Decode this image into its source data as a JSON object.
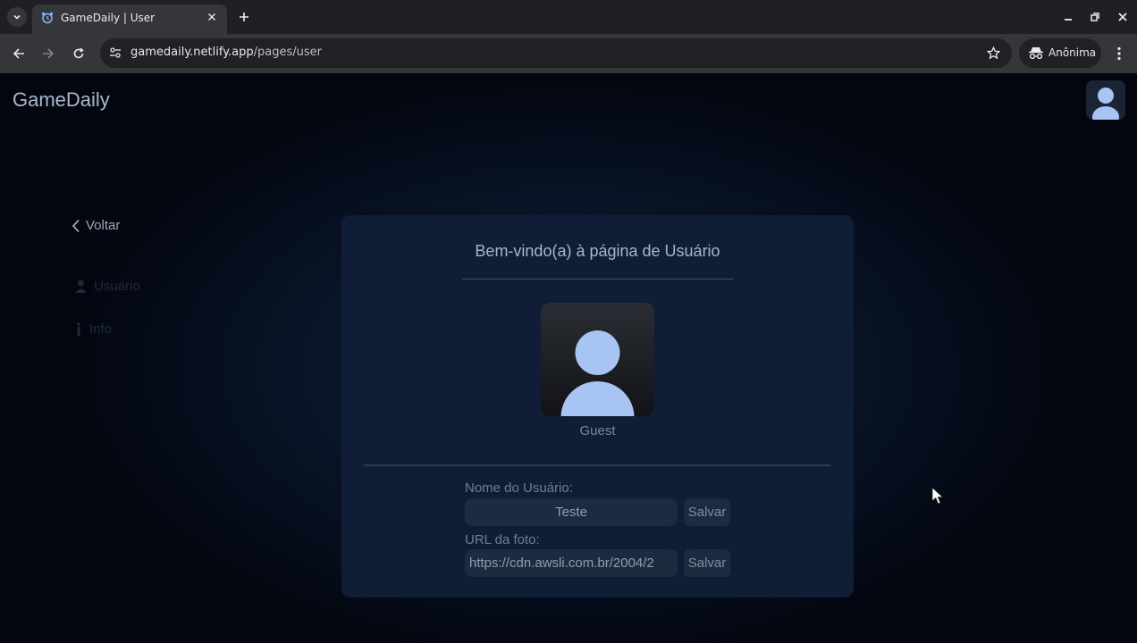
{
  "browser": {
    "tab_title": "GameDaily | User",
    "url_host": "gamedaily.netlify.app",
    "url_path": "/pages/user",
    "incognito_label": "Anônima"
  },
  "header": {
    "brand": "GameDaily"
  },
  "sidebar": {
    "back_label": "Voltar",
    "items": [
      {
        "label": "Usuário",
        "icon": "user-icon"
      },
      {
        "label": "Info",
        "icon": "info-icon"
      }
    ]
  },
  "card": {
    "title": "Bem-vindo(a) à página de Usuário",
    "username": "Guest",
    "name_field": {
      "label": "Nome do Usuário:",
      "value": "Teste",
      "save_label": "Salvar"
    },
    "photo_field": {
      "label": "URL da foto:",
      "value": "https://cdn.awsli.com.br/2004/2",
      "save_label": "Salvar"
    }
  },
  "colors": {
    "page_bg": "#03060f",
    "card_bg": "#0f1e36",
    "avatar_figure": "#a7c4f2"
  }
}
